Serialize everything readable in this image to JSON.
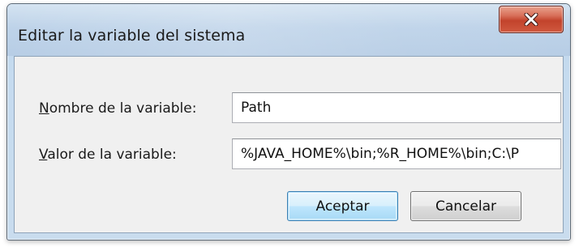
{
  "window": {
    "title": "Editar la variable del sistema",
    "close_icon": "close-icon"
  },
  "form": {
    "name_label_accel": "N",
    "name_label_rest": "ombre de la variable:",
    "name_value": "Path",
    "value_label_accel": "V",
    "value_label_rest": "alor de la variable:",
    "value_value": "%JAVA_HOME%\\bin;%R_HOME%\\bin;C:\\P"
  },
  "buttons": {
    "ok_label": "Aceptar",
    "cancel_label": "Cancelar"
  },
  "colors": {
    "titlebar": "#bcd3ea",
    "client": "#f0f0f0",
    "close_button": "#c2432c",
    "default_button_border": "#3c7fb1"
  }
}
